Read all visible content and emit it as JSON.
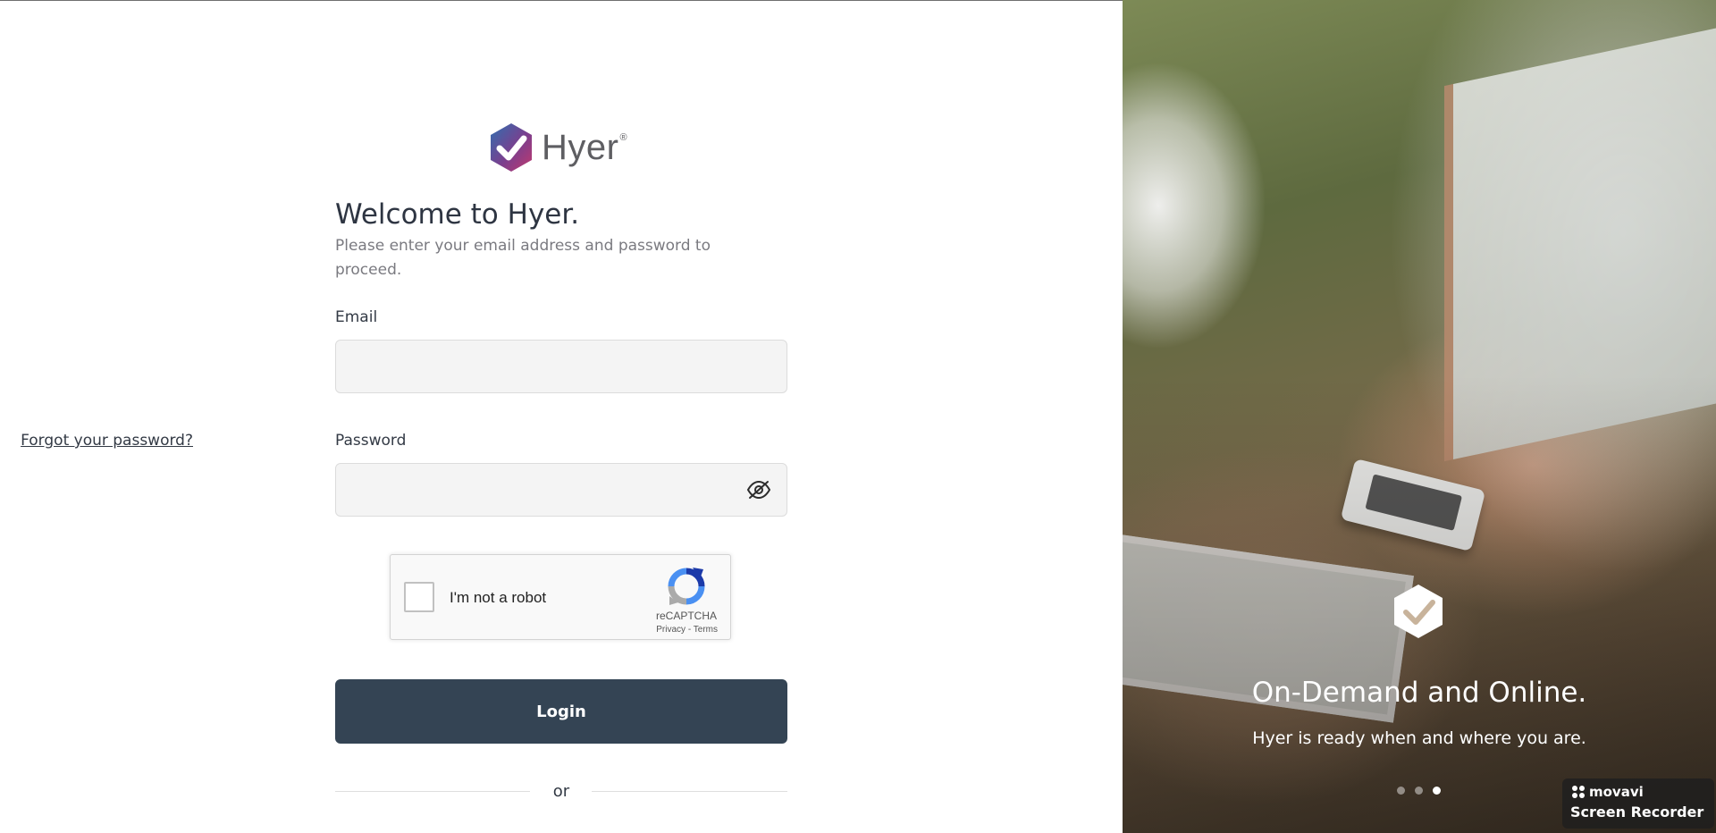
{
  "brand": {
    "name": "Hyer",
    "registered_mark": "®"
  },
  "login": {
    "title": "Welcome to Hyer.",
    "subtitle": "Please enter your email address and password to proceed.",
    "email_label": "Email",
    "email_value": "",
    "password_label": "Password",
    "password_value": "",
    "forgot_password": "Forgot your password?",
    "password_toggle_icon": "eye-off-icon",
    "login_button": "Login",
    "divider_text": "or"
  },
  "recaptcha": {
    "label": "I'm not a robot",
    "brand": "reCAPTCHA",
    "privacy": "Privacy",
    "separator": " - ",
    "terms": "Terms",
    "checked": false
  },
  "hero": {
    "title": "On-Demand and Online.",
    "subtitle": "Hyer is ready when and where you are.",
    "slide_count": 3,
    "active_slide": 3
  },
  "watermark": {
    "brand": "movavi",
    "product": "Screen Recorder"
  },
  "colors": {
    "primary_button": "#344454",
    "logo_gradient": [
      "#2f6fb0",
      "#7b3f8e",
      "#c0396e"
    ],
    "text_dark": "#2e3542",
    "text_muted": "#7a7a80",
    "field_background": "#f4f4f4"
  }
}
